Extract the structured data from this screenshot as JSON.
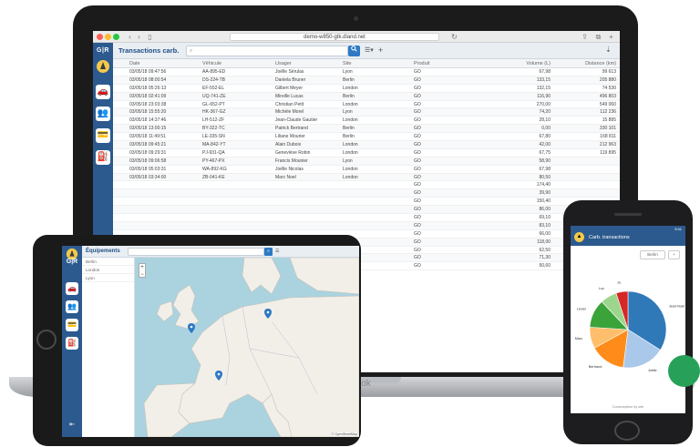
{
  "browser": {
    "url": "demo-w850-gtk.dland.net"
  },
  "laptop_app": {
    "logo": "G|R",
    "title": "Transactions carb.",
    "columns": [
      "Date",
      "Véhicule",
      "Usager",
      "Site",
      "Produit",
      "Volume (L)",
      "Distance (km)"
    ],
    "rows": [
      [
        "03/05/18 09:47:56",
        "AA-895-ED",
        "Joëlle Sérulas",
        "Lyon",
        "GO",
        "67,98",
        "99 613"
      ],
      [
        "03/05/18 08:00:54",
        "DS-224-TB",
        "Daniela Bruner",
        "Berlin",
        "GO",
        "133,15",
        "205 880"
      ],
      [
        "03/05/18 05:26:13",
        "EF-552-EL",
        "Gilbert Meyer",
        "London",
        "GO",
        "132,15",
        "74 530"
      ],
      [
        "03/05/18 02:41:09",
        "UQ-741-ZE",
        "Mireille Lucas",
        "Berlin",
        "GO",
        "116,90",
        "496 803"
      ],
      [
        "03/05/18 23:03:38",
        "GL-652-PT",
        "Christian Petit",
        "London",
        "GO",
        "270,00",
        "549 060"
      ],
      [
        "03/05/18 15:55:20",
        "HK-367-GZ",
        "Michèle Morel",
        "Lyon",
        "GO",
        "74,20",
        "112 236"
      ],
      [
        "03/05/18 14:37:46",
        "LH-512-ZF",
        "Jean-Claude Gautier",
        "London",
        "GO",
        "28,10",
        "15 885"
      ],
      [
        "03/05/18 13:00:15",
        "BY-322-TC",
        "Patrick Bertrand",
        "Berlin",
        "GO",
        "0,00",
        "330 101"
      ],
      [
        "03/05/18 11:49:51",
        "LE-335-SN",
        "Liliane Mourier",
        "Berlin",
        "GO",
        "67,80",
        "168 811"
      ],
      [
        "03/05/18 09:45:21",
        "MA-842-YT",
        "Alain Dubois",
        "London",
        "GO",
        "42,00",
        "212 963"
      ],
      [
        "03/05/18 09:29:31",
        "PJ-931-QA",
        "Geneviève Robin",
        "London",
        "GO",
        "67,75",
        "119 895"
      ],
      [
        "03/05/18 09:06:58",
        "PY-467-PX",
        "Francis Mounier",
        "Lyon",
        "GO",
        "58,90",
        ""
      ],
      [
        "03/05/18 05:03:31",
        "WA-892-KG",
        "Joëlle Nicolas",
        "London",
        "GO",
        "67,98",
        ""
      ],
      [
        "03/05/18 03:34:00",
        "ZB-041-KE",
        "Marc Noel",
        "London",
        "GO",
        "80,50",
        ""
      ],
      [
        "",
        "",
        "",
        "",
        "GO",
        "174,40",
        ""
      ],
      [
        "",
        "",
        "",
        "",
        "GO",
        "39,90",
        ""
      ],
      [
        "",
        "",
        "",
        "",
        "GO",
        "150,40",
        ""
      ],
      [
        "",
        "",
        "",
        "",
        "GO",
        "86,00",
        ""
      ],
      [
        "",
        "",
        "",
        "",
        "GO",
        "69,10",
        ""
      ],
      [
        "",
        "",
        "",
        "",
        "GO",
        "83,10",
        ""
      ],
      [
        "",
        "",
        "",
        "",
        "GO",
        "66,00",
        ""
      ],
      [
        "",
        "",
        "",
        "",
        "GO",
        "118,00",
        ""
      ],
      [
        "",
        "",
        "",
        "",
        "GO",
        "62,50",
        ""
      ],
      [
        "",
        "",
        "",
        "",
        "GO",
        "71,30",
        ""
      ],
      [
        "",
        "",
        "",
        "",
        "GO",
        "50,60",
        ""
      ]
    ]
  },
  "laptop_brand": "Book",
  "tablet_app": {
    "logo": "G|R",
    "title": "Équipements",
    "list_items": [
      "Berlin",
      "London",
      "Lyon"
    ]
  },
  "phone_app": {
    "status": "9:41",
    "title": "Carb. transactions",
    "filter_btn": "Berlin",
    "add_btn": "+",
    "caption": "Consumption by site",
    "pie": {
      "type": "pie",
      "slices": [
        {
          "label": "Jean-Noël",
          "value": 34,
          "color": "#2f79b9"
        },
        {
          "label": "Joëlle",
          "value": 18,
          "color": "#a9c8ea"
        },
        {
          "label": "Bertrand",
          "value": 15,
          "color": "#ff8c1a"
        },
        {
          "label": "Marc",
          "value": 9,
          "color": "#ffbe6b"
        },
        {
          "label": "Lionel",
          "value": 12,
          "color": "#3aa33a"
        },
        {
          "label": "Luc",
          "value": 7,
          "color": "#9bd68c"
        },
        {
          "label": "Jo",
          "value": 5,
          "color": "#d62728"
        }
      ]
    }
  },
  "colors": {
    "brand_blue": "#2c5a8e",
    "accent_green": "#27a159"
  }
}
